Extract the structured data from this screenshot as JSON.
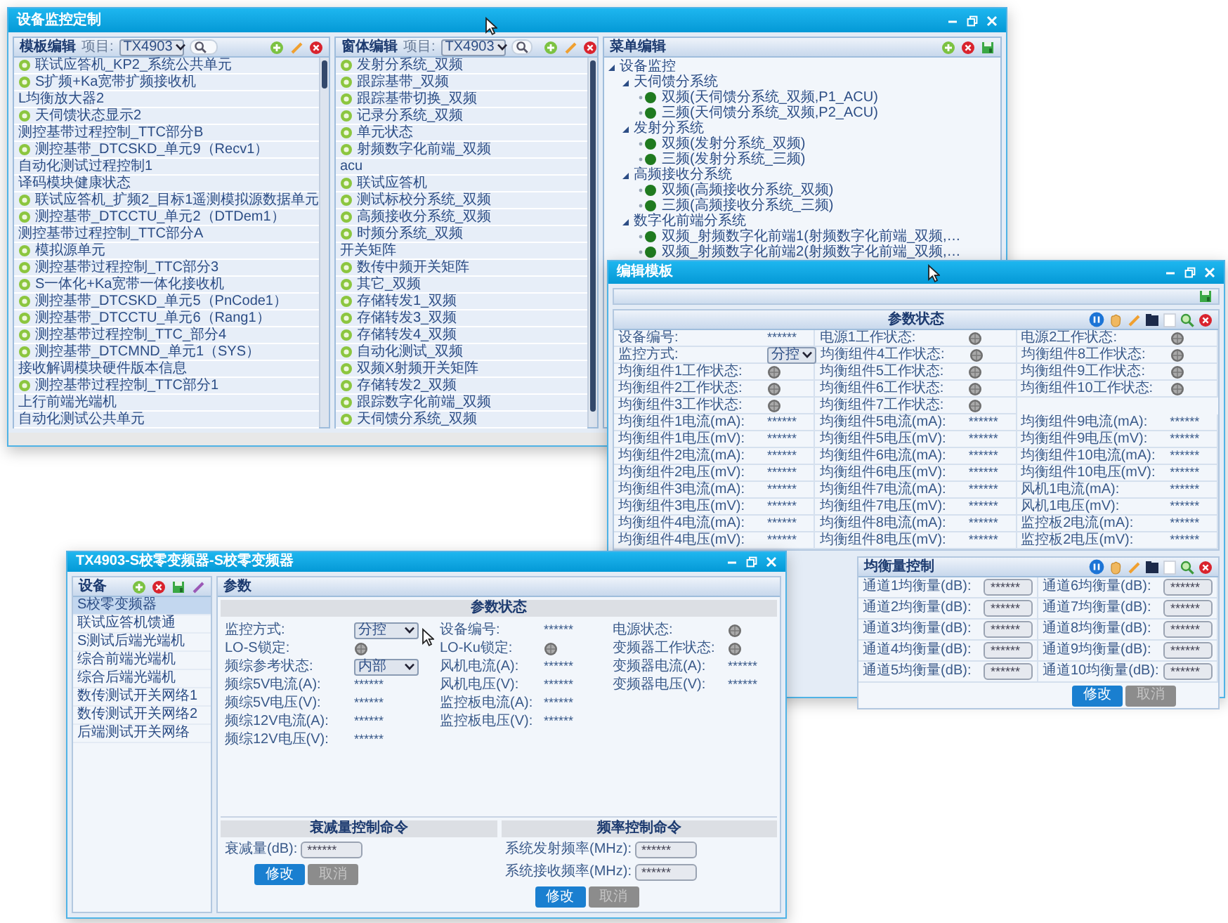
{
  "window_main": {
    "title": "设备监控定制",
    "panels": [
      {
        "title": "模板编辑",
        "project_label": "项目:",
        "project": "TX4903",
        "items": [
          {
            "label": "联试应答机_KP2_系统公共单元",
            "kind": "device"
          },
          {
            "label": "S扩频+Ka宽带扩频接收机",
            "kind": "device"
          },
          {
            "label": "L均衡放大器2",
            "kind": "plain"
          },
          {
            "label": "天伺馈状态显示2",
            "kind": "device"
          },
          {
            "label": "测控基带过程控制_TTC部分B",
            "kind": "plain"
          },
          {
            "label": "测控基带_DTCSKD_单元9（Recv1）",
            "kind": "device"
          },
          {
            "label": "自动化测试过程控制1",
            "kind": "plain"
          },
          {
            "label": "译码模块健康状态",
            "kind": "plain"
          },
          {
            "label": "联试应答机_扩频2_目标1遥测模拟源数据单元",
            "kind": "device"
          },
          {
            "label": "测控基带_DTCCTU_单元2（DTDem1）",
            "kind": "device"
          },
          {
            "label": "测控基带过程控制_TTC部分A",
            "kind": "plain"
          },
          {
            "label": "模拟源单元",
            "kind": "device"
          },
          {
            "label": "测控基带过程控制_TTC部分3",
            "kind": "device"
          },
          {
            "label": "S一体化+Ka宽带一体化接收机",
            "kind": "device"
          },
          {
            "label": "测控基带_DTCSKD_单元5（PnCode1）",
            "kind": "device"
          },
          {
            "label": "测控基带_DTCCTU_单元6（Rang1）",
            "kind": "device"
          },
          {
            "label": "测控基带过程控制_TTC_部分4",
            "kind": "device"
          },
          {
            "label": "测控基带_DTCMND_单元1（SYS）",
            "kind": "device"
          },
          {
            "label": "接收解调模块硬件版本信息",
            "kind": "plain"
          },
          {
            "label": "测控基带过程控制_TTC部分1",
            "kind": "device"
          },
          {
            "label": "上行前端光端机",
            "kind": "plain"
          },
          {
            "label": "自动化测试公共单元",
            "kind": "plain"
          }
        ]
      },
      {
        "title": "窗体编辑",
        "project_label": "项目:",
        "project": "TX4903",
        "items": [
          {
            "label": "发射分系统_双频",
            "kind": "device"
          },
          {
            "label": "跟踪基带_双频",
            "kind": "device"
          },
          {
            "label": "跟踪基带切换_双频",
            "kind": "device"
          },
          {
            "label": "记录分系统_双频",
            "kind": "device"
          },
          {
            "label": "单元状态",
            "kind": "device"
          },
          {
            "label": "射频数字化前端_双频",
            "kind": "device"
          },
          {
            "label": "acu",
            "kind": "plain"
          },
          {
            "label": "联试应答机",
            "kind": "device"
          },
          {
            "label": "测试标校分系统_双频",
            "kind": "device"
          },
          {
            "label": "高频接收分系统_双频",
            "kind": "device"
          },
          {
            "label": "时频分系统_双频",
            "kind": "device"
          },
          {
            "label": "开关矩阵",
            "kind": "plain"
          },
          {
            "label": "数传中频开关矩阵",
            "kind": "device"
          },
          {
            "label": "其它_双频",
            "kind": "device"
          },
          {
            "label": "存储转发1_双频",
            "kind": "device"
          },
          {
            "label": "存储转发3_双频",
            "kind": "device"
          },
          {
            "label": "存储转发4_双频",
            "kind": "device"
          },
          {
            "label": "自动化测试_双频",
            "kind": "device"
          },
          {
            "label": "双频X射频开关矩阵",
            "kind": "device"
          },
          {
            "label": "存储转发2_双频",
            "kind": "device"
          },
          {
            "label": "跟踪数字化前端_双频",
            "kind": "device"
          },
          {
            "label": "天伺馈分系统_双频",
            "kind": "device"
          }
        ]
      }
    ],
    "menu_panel": {
      "title": "菜单编辑",
      "tree": [
        {
          "label": "设备监控",
          "kind": "group",
          "expanded": true,
          "children": [
            {
              "label": "天伺馈分系统",
              "kind": "group",
              "expanded": true,
              "children": [
                {
                  "label": "双频(天伺馈分系统_双频,P1_ACU)",
                  "kind": "device"
                },
                {
                  "label": "三频(天伺馈分系统_双频,P2_ACU)",
                  "kind": "device"
                }
              ]
            },
            {
              "label": "发射分系统",
              "kind": "group",
              "expanded": true,
              "children": [
                {
                  "label": "双频(发射分系统_双频)",
                  "kind": "device"
                },
                {
                  "label": "三频(发射分系统_三频)",
                  "kind": "device"
                }
              ]
            },
            {
              "label": "高频接收分系统",
              "kind": "group",
              "expanded": true,
              "children": [
                {
                  "label": "双频(高频接收分系统_双频)",
                  "kind": "device"
                },
                {
                  "label": "三频(高频接收分系统_三频)",
                  "kind": "device"
                }
              ]
            },
            {
              "label": "数字化前端分系统",
              "kind": "group",
              "expanded": true,
              "children": [
                {
                  "label": "双频_射频数字化前端1(射频数字化前端_双频,…",
                  "kind": "device"
                },
                {
                  "label": "双频_射频数字化前端2(射频数字化前端_双频,…",
                  "kind": "device"
                }
              ]
            }
          ]
        }
      ]
    }
  },
  "window_template": {
    "title": "编辑模板",
    "param_panel": {
      "title": "参数状态",
      "rows": [
        [
          {
            "label": "设备编号:",
            "kind": "text",
            "value": "******"
          },
          {
            "label": "电源1工作状态:",
            "kind": "lamp"
          },
          {
            "label": "电源2工作状态:",
            "kind": "lamp"
          }
        ],
        [
          {
            "label": "监控方式:",
            "kind": "select",
            "value": "分控"
          },
          {
            "label": "均衡组件4工作状态:",
            "kind": "lamp"
          },
          {
            "label": "均衡组件8工作状态:",
            "kind": "lamp"
          }
        ],
        [
          {
            "label": "均衡组件1工作状态:",
            "kind": "lamp"
          },
          {
            "label": "均衡组件5工作状态:",
            "kind": "lamp"
          },
          {
            "label": "均衡组件9工作状态:",
            "kind": "lamp"
          }
        ],
        [
          {
            "label": "均衡组件2工作状态:",
            "kind": "lamp"
          },
          {
            "label": "均衡组件6工作状态:",
            "kind": "lamp"
          },
          {
            "label": "均衡组件10工作状态:",
            "kind": "lamp"
          }
        ],
        [
          {
            "label": "均衡组件3工作状态:",
            "kind": "lamp"
          },
          {
            "label": "均衡组件7工作状态:",
            "kind": "lamp"
          },
          null
        ],
        [
          {
            "label": "均衡组件1电流(mA):",
            "kind": "text",
            "value": "******"
          },
          {
            "label": "均衡组件5电流(mA):",
            "kind": "text",
            "value": "******"
          },
          {
            "label": "均衡组件9电流(mA):",
            "kind": "text",
            "value": "******"
          }
        ],
        [
          {
            "label": "均衡组件1电压(mV):",
            "kind": "text",
            "value": "******"
          },
          {
            "label": "均衡组件5电压(mV):",
            "kind": "text",
            "value": "******"
          },
          {
            "label": "均衡组件9电压(mV):",
            "kind": "text",
            "value": "******"
          }
        ],
        [
          {
            "label": "均衡组件2电流(mA):",
            "kind": "text",
            "value": "******"
          },
          {
            "label": "均衡组件6电流(mA):",
            "kind": "text",
            "value": "******"
          },
          {
            "label": "均衡组件10电流(mA):",
            "kind": "text",
            "value": "******"
          }
        ],
        [
          {
            "label": "均衡组件2电压(mV):",
            "kind": "text",
            "value": "******"
          },
          {
            "label": "均衡组件6电压(mV):",
            "kind": "text",
            "value": "******"
          },
          {
            "label": "均衡组件10电压(mV):",
            "kind": "text",
            "value": "******"
          }
        ],
        [
          {
            "label": "均衡组件3电流(mA):",
            "kind": "text",
            "value": "******"
          },
          {
            "label": "均衡组件7电流(mA):",
            "kind": "text",
            "value": "******"
          },
          {
            "label": "风机1电流(mA):",
            "kind": "text",
            "value": "******"
          }
        ],
        [
          {
            "label": "均衡组件3电压(mV):",
            "kind": "text",
            "value": "******"
          },
          {
            "label": "均衡组件7电压(mV):",
            "kind": "text",
            "value": "******"
          },
          {
            "label": "风机1电压(mV):",
            "kind": "text",
            "value": "******"
          }
        ],
        [
          {
            "label": "均衡组件4电流(mA):",
            "kind": "text",
            "value": "******"
          },
          {
            "label": "均衡组件8电流(mA):",
            "kind": "text",
            "value": "******"
          },
          {
            "label": "监控板2电流(mA):",
            "kind": "text",
            "value": "******"
          }
        ],
        [
          {
            "label": "均衡组件4电压(mV):",
            "kind": "text",
            "value": "******"
          },
          {
            "label": "均衡组件8电压(mV):",
            "kind": "text",
            "value": "******"
          },
          {
            "label": "监控板2电压(mV):",
            "kind": "text",
            "value": "******"
          }
        ]
      ]
    },
    "balance_panel": {
      "title": "均衡量控制",
      "channels": [
        {
          "label": "通道1均衡量(dB):",
          "value": "******"
        },
        {
          "label": "通道6均衡量(dB):",
          "value": "******"
        },
        {
          "label": "通道2均衡量(dB):",
          "value": "******"
        },
        {
          "label": "通道7均衡量(dB):",
          "value": "******"
        },
        {
          "label": "通道3均衡量(dB):",
          "value": "******"
        },
        {
          "label": "通道8均衡量(dB):",
          "value": "******"
        },
        {
          "label": "通道4均衡量(dB):",
          "value": "******"
        },
        {
          "label": "通道9均衡量(dB):",
          "value": "******"
        },
        {
          "label": "通道5均衡量(dB):",
          "value": "******"
        },
        {
          "label": "通道10均衡量(dB):",
          "value": "******"
        }
      ],
      "buttons": [
        {
          "label": "修改",
          "disabled": false
        },
        {
          "label": "取消",
          "disabled": true
        }
      ]
    }
  },
  "window_device": {
    "title": "TX4903-S校零变频器-S校零变频器",
    "device_panel": {
      "title": "设备",
      "items": [
        {
          "label": "S校零变频器",
          "selected": true
        },
        {
          "label": "联试应答机馈通",
          "selected": false
        },
        {
          "label": "S测试后端光端机",
          "selected": false
        },
        {
          "label": "综合前端光端机",
          "selected": false
        },
        {
          "label": "综合后端光端机",
          "selected": false
        },
        {
          "label": "数传测试开关网络1",
          "selected": false
        },
        {
          "label": "数传测试开关网络2",
          "selected": false
        },
        {
          "label": "后端测试开关网络",
          "selected": false
        }
      ]
    },
    "param_panel": {
      "title": "参数",
      "section": "参数状态",
      "columns": [
        [
          {
            "label": "监控方式:",
            "kind": "select",
            "value": "分控"
          },
          {
            "label": "LO-S锁定:",
            "kind": "lamp"
          },
          {
            "label": "频综参考状态:",
            "kind": "select",
            "value": "内部"
          },
          {
            "label": "频综5V电流(A):",
            "kind": "text",
            "value": "******"
          },
          {
            "label": "频综5V电压(V):",
            "kind": "text",
            "value": "******"
          },
          {
            "label": "频综12V电流(A):",
            "kind": "text",
            "value": "******"
          },
          {
            "label": "频综12V电压(V):",
            "kind": "text",
            "value": "******"
          }
        ],
        [
          {
            "label": "设备编号:",
            "kind": "text",
            "value": "******"
          },
          {
            "label": "LO-Ku锁定:",
            "kind": "lamp"
          },
          {
            "label": "风机电流(A):",
            "kind": "text",
            "value": "******"
          },
          {
            "label": "风机电压(V):",
            "kind": "text",
            "value": "******"
          },
          {
            "label": "监控板电流(A):",
            "kind": "text",
            "value": "******"
          },
          {
            "label": "监控板电压(V):",
            "kind": "text",
            "value": "******"
          }
        ],
        [
          {
            "label": "电源状态:",
            "kind": "lamp"
          },
          {
            "label": "变频器工作状态:",
            "kind": "lamp"
          },
          {
            "label": "变频器电流(A):",
            "kind": "text",
            "value": "******"
          },
          {
            "label": "变频器电压(V):",
            "kind": "text",
            "value": "******"
          }
        ]
      ]
    },
    "commands": [
      {
        "title": "衰减量控制命令",
        "fields": [
          {
            "label": "衰减量(dB):",
            "value": "******"
          }
        ],
        "buttons": [
          {
            "label": "修改",
            "disabled": false
          },
          {
            "label": "取消",
            "disabled": true
          }
        ]
      },
      {
        "title": "频率控制命令",
        "fields": [
          {
            "label": "系统发射频率(MHz):",
            "value": "******"
          },
          {
            "label": "系统接收频率(MHz):",
            "value": "******"
          }
        ],
        "buttons": [
          {
            "label": "修改",
            "disabled": false
          },
          {
            "label": "取消",
            "disabled": true
          }
        ]
      }
    ]
  }
}
